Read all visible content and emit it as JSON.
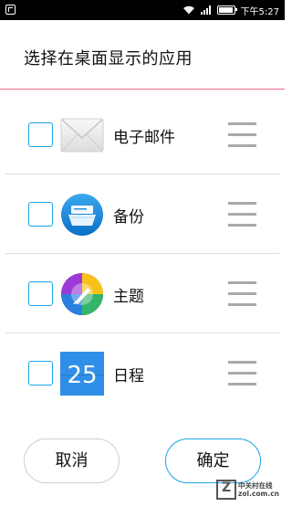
{
  "status_bar": {
    "time": "下午5:27",
    "icons": [
      "screenshot-icon",
      "wifi-icon",
      "signal-icon",
      "battery-icon"
    ]
  },
  "dialog": {
    "title": "选择在桌面显示的应用",
    "apps": [
      {
        "label": "电子邮件",
        "icon": "email-icon",
        "checked": false
      },
      {
        "label": "备份",
        "icon": "backup-icon",
        "checked": false
      },
      {
        "label": "主题",
        "icon": "theme-icon",
        "checked": false
      },
      {
        "label": "日程",
        "icon": "calendar-icon",
        "icon_text": "25",
        "checked": false
      }
    ],
    "cancel_label": "取消",
    "ok_label": "确定"
  },
  "watermark": {
    "line1": "中关村在线",
    "line2": "zol.com.cn"
  },
  "colors": {
    "accent": "#1aa6e6",
    "title_divider": "#ef6b88",
    "handle": "#a9a9a9"
  }
}
